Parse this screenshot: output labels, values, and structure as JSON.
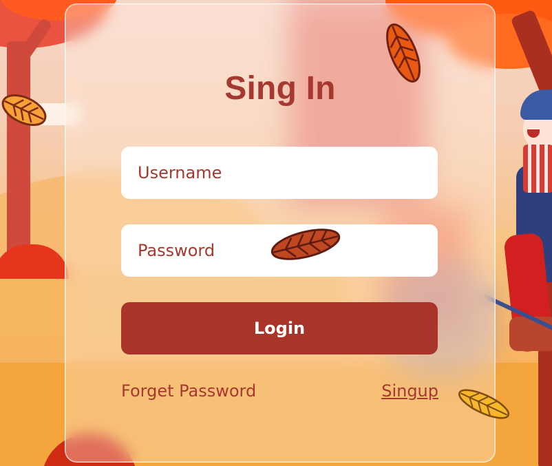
{
  "form": {
    "title": "Sing In",
    "username_placeholder": "Username",
    "password_placeholder": "Password",
    "login_label": "Login",
    "forgot_label": "Forget Password",
    "signup_label": "Singup"
  },
  "colors": {
    "accent": "#a6392f",
    "button": "#a9342a",
    "input_bg": "#ffffff"
  },
  "decorations": {
    "leaf_icons": [
      "leaf-icon",
      "leaf-icon",
      "leaf-icon",
      "leaf-icon"
    ]
  }
}
